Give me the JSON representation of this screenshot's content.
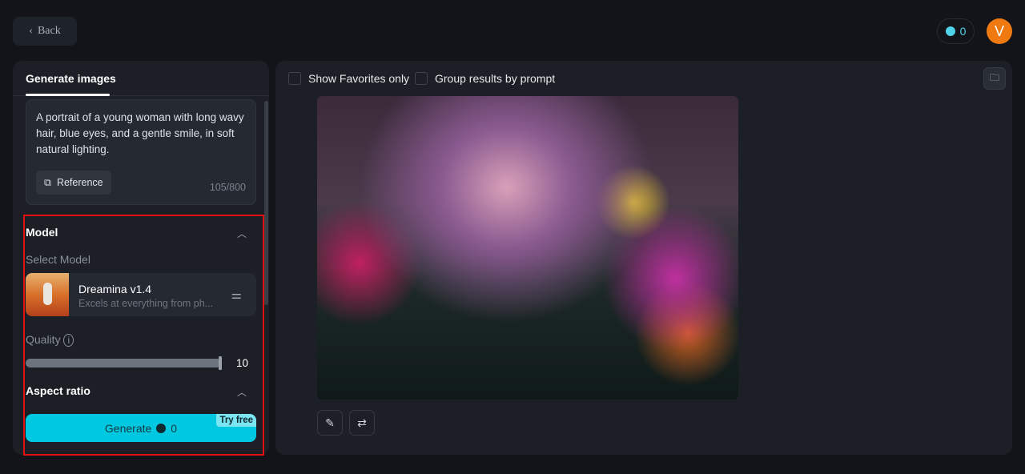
{
  "header": {
    "back_label": "Back",
    "credits": "0",
    "avatar_initial": "V"
  },
  "left_panel": {
    "tab": "Generate images",
    "prompt": {
      "text": "A portrait of a young woman with long wavy hair, blue eyes, and a gentle smile, in soft natural lighting.",
      "reference_label": "Reference",
      "char_count": "105/800"
    },
    "model_section": {
      "title": "Model",
      "select_label": "Select Model",
      "model_name": "Dreamina v1.4",
      "model_desc": "Excels at everything from ph..."
    },
    "quality": {
      "label": "Quality",
      "value": "10",
      "fraction": 1.0
    },
    "aspect_ratio": {
      "title": "Aspect ratio"
    },
    "generate": {
      "label": "Generate",
      "cost": "0",
      "badge": "Try free"
    }
  },
  "main": {
    "show_favorites_label": "Show Favorites only",
    "group_by_prompt_label": "Group results by prompt"
  },
  "colors": {
    "accent": "#00c8e0",
    "avatar": "#f07a10",
    "highlight": "#e01010"
  }
}
